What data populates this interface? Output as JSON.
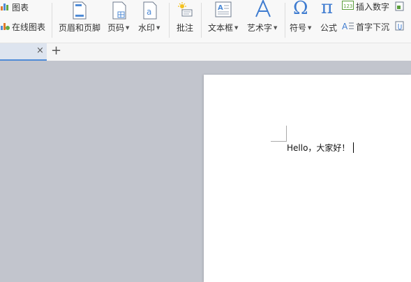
{
  "ribbon": {
    "chart_label": "图表",
    "online_chart_label": "在线图表",
    "header_footer_label": "页眉和页脚",
    "page_number_label": "页码",
    "watermark_label": "水印",
    "comment_label": "批注",
    "textbox_label": "文本框",
    "wordart_label": "艺术字",
    "symbol_label": "符号",
    "formula_label": "公式",
    "insert_number_label": "插入数字",
    "drop_cap_label": "首字下沉",
    "icon_text_123": "123",
    "icon_text_a": "a",
    "icon_text_A": "A"
  },
  "tabs": {
    "close_glyph": "×",
    "add_glyph": "+"
  },
  "document": {
    "text": "Hello，大家好！"
  },
  "colors": {
    "accent": "#4f8bd6",
    "workspace_bg": "#c2c5cd",
    "ribbon_bg": "#f8f8f8"
  }
}
